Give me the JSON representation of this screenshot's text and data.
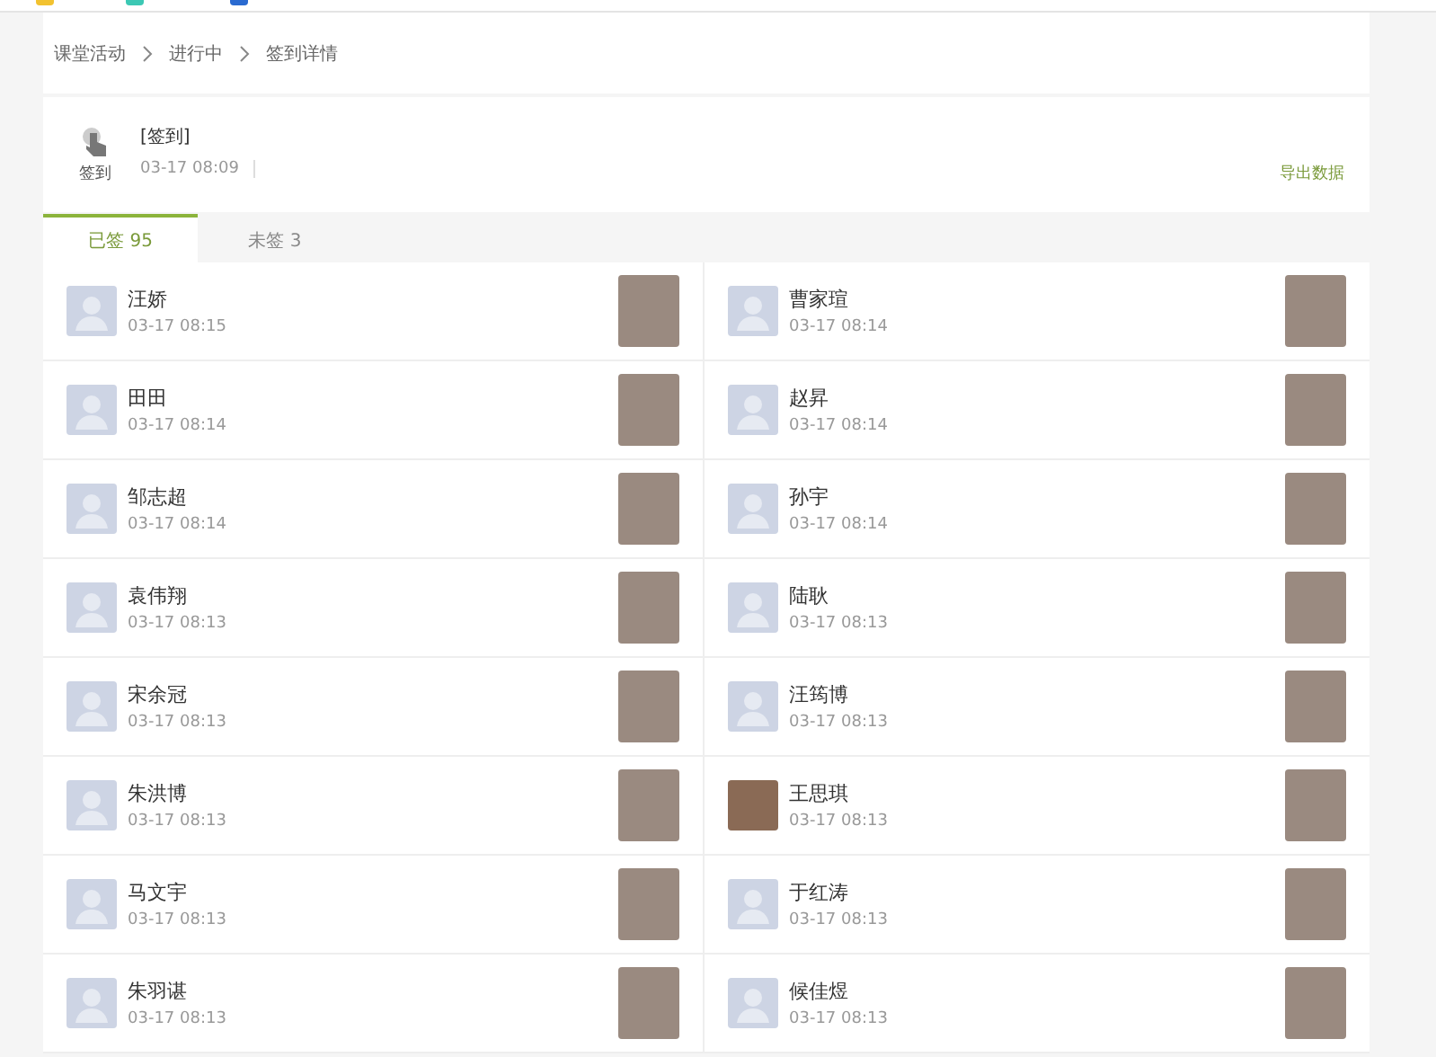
{
  "breadcrumb": [
    "课堂活动",
    "进行中",
    "签到详情"
  ],
  "activity": {
    "type_label": "签到",
    "title": "[签到]",
    "time": "03-17 08:09",
    "export": "导出数据"
  },
  "tabs": [
    {
      "label": "已签 95",
      "selected": true
    },
    {
      "label": "未签 3",
      "selected": false
    }
  ],
  "students": [
    {
      "name": "汪娇",
      "time": "03-17 08:15",
      "kind": "default"
    },
    {
      "name": "曹家瑄",
      "time": "03-17 08:14",
      "kind": "default"
    },
    {
      "name": "田田",
      "time": "03-17 08:14",
      "kind": "default"
    },
    {
      "name": "赵昇",
      "time": "03-17 08:14",
      "kind": "default"
    },
    {
      "name": "邹志超",
      "time": "03-17 08:14",
      "kind": "default"
    },
    {
      "name": "孙宇",
      "time": "03-17 08:14",
      "kind": "default"
    },
    {
      "name": "袁伟翔",
      "time": "03-17 08:13",
      "kind": "default"
    },
    {
      "name": "陆耿",
      "time": "03-17 08:13",
      "kind": "default"
    },
    {
      "name": "宋余冠",
      "time": "03-17 08:13",
      "kind": "default"
    },
    {
      "name": "汪筠博",
      "time": "03-17 08:13",
      "kind": "default"
    },
    {
      "name": "朱洪博",
      "time": "03-17 08:13",
      "kind": "default"
    },
    {
      "name": "王思琪",
      "time": "03-17 08:13",
      "kind": "photo"
    },
    {
      "name": "马文宇",
      "time": "03-17 08:13",
      "kind": "default"
    },
    {
      "name": "于红涛",
      "time": "03-17 08:13",
      "kind": "default"
    },
    {
      "name": "朱羽谌",
      "time": "03-17 08:13",
      "kind": "default"
    },
    {
      "name": "候佳煜",
      "time": "03-17 08:13",
      "kind": "default"
    }
  ]
}
